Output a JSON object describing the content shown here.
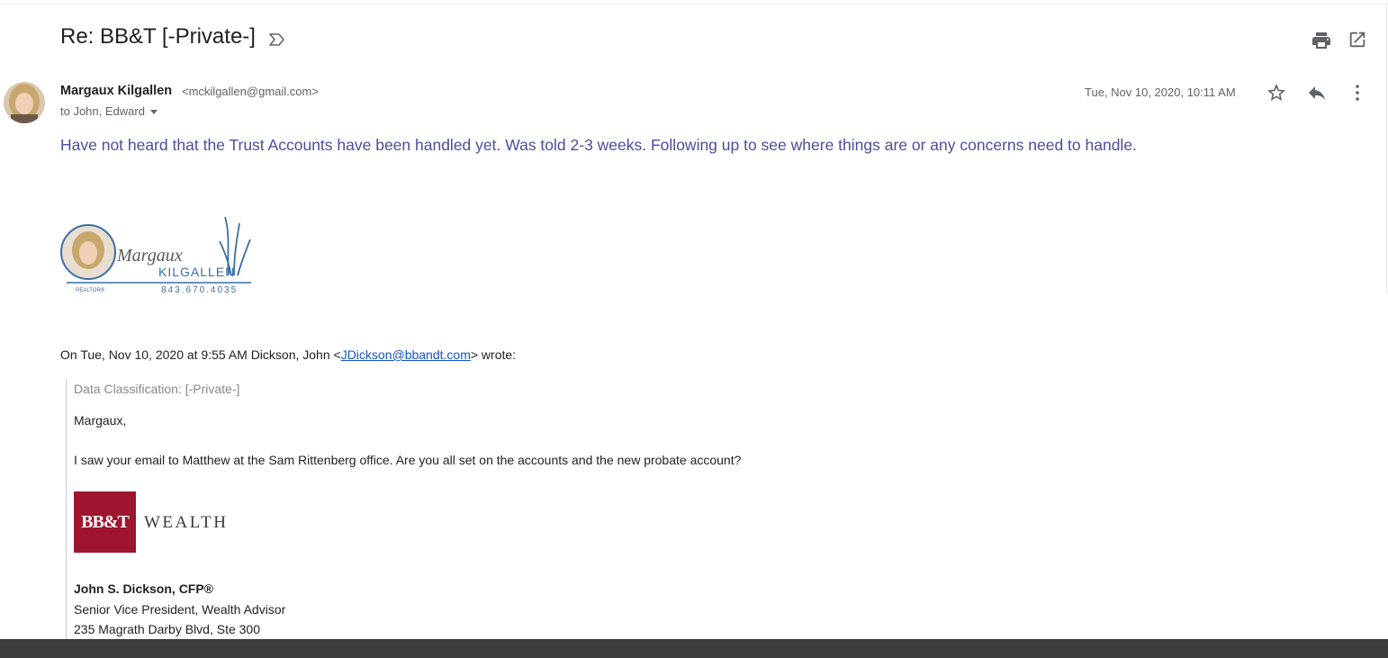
{
  "email": {
    "subject": "Re: BB&T [-Private-]",
    "sender_name": "Margaux Kilgallen",
    "sender_email": "<mckilgallen@gmail.com>",
    "recipients": "to John, Edward",
    "date": "Tue, Nov 10, 2020, 10:11 AM",
    "message": "Have not heard that the Trust Accounts have been handled yet.  Was told 2-3 weeks. Following up to see where things are or any concerns need to handle."
  },
  "signature_logo": {
    "first_name": "Margaux",
    "last_name": "KILGALLEN",
    "phone": "843.670.4035",
    "tag": "REALTOR®"
  },
  "quoted": {
    "attribution_prefix": "On Tue, Nov 10, 2020 at 9:55 AM Dickson, John <",
    "attribution_email": "JDickson@bbandt.com",
    "attribution_suffix": "> wrote:",
    "classification": "Data Classification: [-Private-]",
    "greeting": "Margaux,",
    "body": "I saw your email to Matthew at the Sam Rittenberg office. Are you all set on the accounts and the new probate account?",
    "logo_text": "BB&T",
    "logo_wordmark": "WEALTH",
    "sig_name": "John S. Dickson, CFP®",
    "sig_title": "Senior Vice President, Wealth Advisor",
    "sig_address": "235 Magrath Darby Blvd, Ste 300"
  },
  "icons": {
    "important": "important-marker-icon",
    "print": "print-icon",
    "new_window": "open-in-new-window-icon",
    "star": "star-icon",
    "reply": "reply-icon",
    "more": "more-vertical-icon"
  },
  "colors": {
    "message_text": "#4b4e9e",
    "link": "#1155cc",
    "bbt_brand": "#9e1530",
    "icon_gray": "#5f6368"
  }
}
